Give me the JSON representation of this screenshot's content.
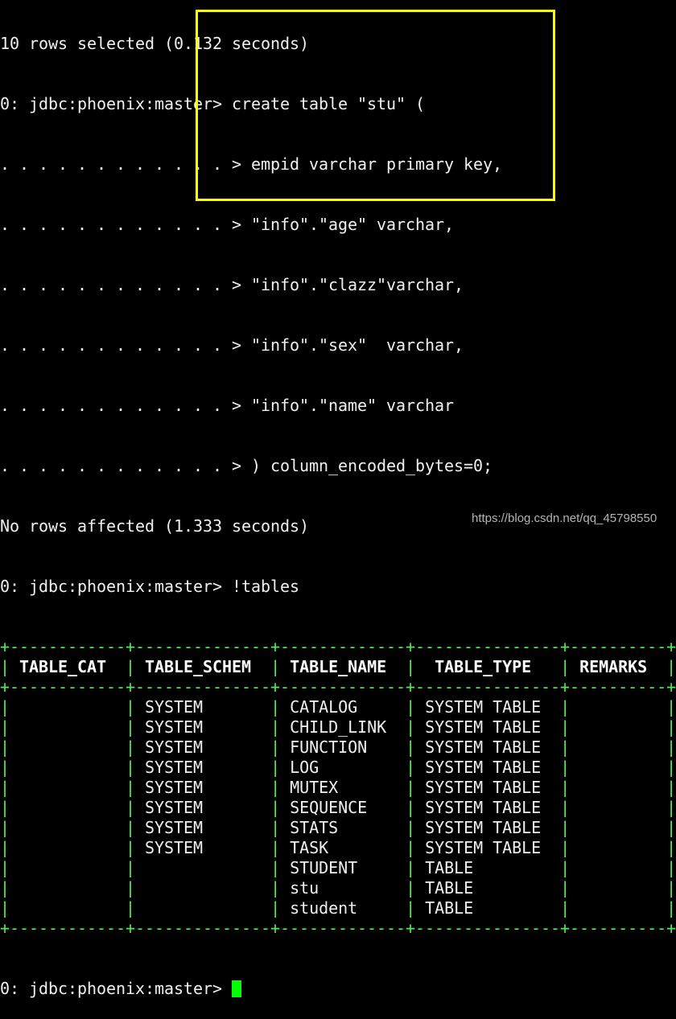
{
  "terminal": {
    "prev_output": "10 rows selected (0.132 seconds)",
    "prompt": "0: jdbc:phoenix:master> ",
    "continuation_prompt": ". . . . . . . . . . . . > ",
    "command_lines": [
      "create table \"stu\" (",
      "empid varchar primary key,",
      "\"info\".\"age\" varchar,",
      "\"info\".\"clazz\"varchar,",
      "\"info\".\"sex\"  varchar,",
      "\"info\".\"name\" varchar",
      ") column_encoded_bytes=0;"
    ],
    "result_message": "No rows affected (1.333 seconds)",
    "second_command": "!tables",
    "final_prompt": "0: jdbc:phoenix:master> "
  },
  "table": {
    "columns": [
      "TABLE_CAT",
      "TABLE_SCHEM",
      "TABLE_NAME",
      "TABLE_TYPE",
      "REMARKS"
    ],
    "rows": [
      [
        "",
        "SYSTEM",
        "CATALOG",
        "SYSTEM TABLE",
        ""
      ],
      [
        "",
        "SYSTEM",
        "CHILD_LINK",
        "SYSTEM TABLE",
        ""
      ],
      [
        "",
        "SYSTEM",
        "FUNCTION",
        "SYSTEM TABLE",
        ""
      ],
      [
        "",
        "SYSTEM",
        "LOG",
        "SYSTEM TABLE",
        ""
      ],
      [
        "",
        "SYSTEM",
        "MUTEX",
        "SYSTEM TABLE",
        ""
      ],
      [
        "",
        "SYSTEM",
        "SEQUENCE",
        "SYSTEM TABLE",
        ""
      ],
      [
        "",
        "SYSTEM",
        "STATS",
        "SYSTEM TABLE",
        ""
      ],
      [
        "",
        "SYSTEM",
        "TASK",
        "SYSTEM TABLE",
        ""
      ],
      [
        "",
        "",
        "STUDENT",
        "TABLE",
        ""
      ],
      [
        "",
        "",
        "stu",
        "TABLE",
        ""
      ],
      [
        "",
        "",
        "student",
        "TABLE",
        ""
      ]
    ]
  },
  "colors": {
    "border": "#4cf04c",
    "highlight": "#ffff00",
    "cursor": "#00ff00"
  },
  "watermark": "https://blog.csdn.net/qq_45798550"
}
